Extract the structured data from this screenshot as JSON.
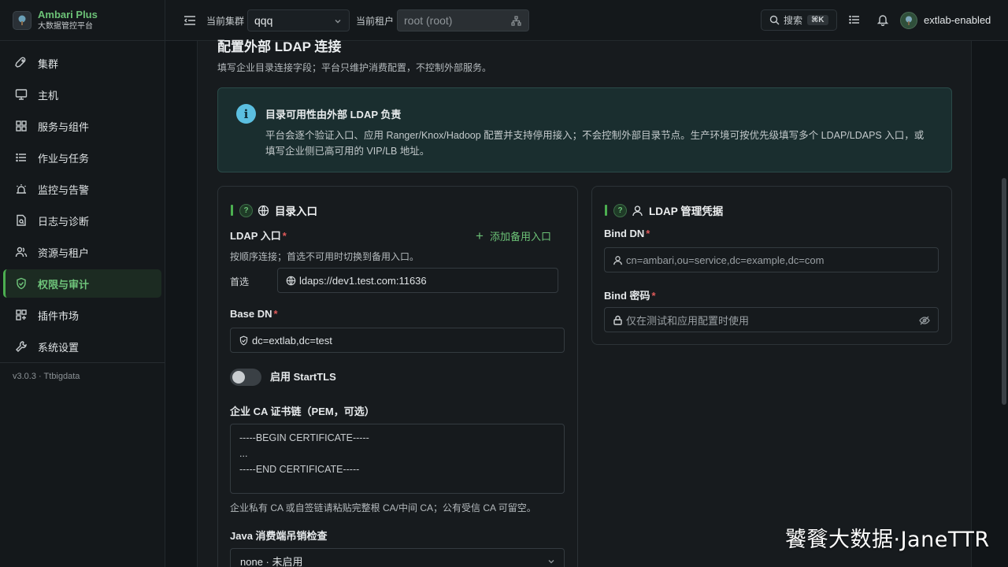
{
  "brand": {
    "name": "Ambari Plus",
    "subtitle": "大数据管控平台"
  },
  "sidebar": {
    "items": [
      {
        "label": "集群",
        "icon": "rocket-icon"
      },
      {
        "label": "主机",
        "icon": "monitor-icon"
      },
      {
        "label": "服务与组件",
        "icon": "grid-icon"
      },
      {
        "label": "作业与任务",
        "icon": "list-icon"
      },
      {
        "label": "监控与告警",
        "icon": "alarm-icon"
      },
      {
        "label": "日志与诊断",
        "icon": "file-search-icon"
      },
      {
        "label": "资源与租户",
        "icon": "users-icon"
      },
      {
        "label": "权限与审计",
        "icon": "shield-check-icon",
        "active": true
      },
      {
        "label": "插件市场",
        "icon": "puzzle-icon"
      },
      {
        "label": "系统设置",
        "icon": "wrench-icon"
      }
    ],
    "version": "v3.0.3 · Ttbigdata"
  },
  "topbar": {
    "cluster_label": "当前集群",
    "cluster_value": "qqq",
    "tenant_label": "当前租户",
    "tenant_value": "root (root)",
    "search_label": "搜索",
    "search_shortcut": "⌘K",
    "user_name": "extlab-enabled"
  },
  "page": {
    "title": "配置外部 LDAP 连接",
    "subtitle": "填写企业目录连接字段；平台只维护消费配置，不控制外部服务。"
  },
  "notice": {
    "title": "目录可用性由外部 LDAP 负责",
    "text": "平台会逐个验证入口、应用 Ranger/Knox/Hadoop 配置并支持停用接入；不会控制外部目录节点。生产环境可按优先级填写多个 LDAP/LDAPS 入口，或填写企业侧已高可用的 VIP/LB 地址。"
  },
  "directory_card": {
    "title": "目录入口",
    "ldap_entry_label": "LDAP 入口",
    "add_backup_label": "添加备用入口",
    "ldap_entry_hint": "按顺序连接；首选不可用时切换到备用入口。",
    "preferred_label": "首选",
    "preferred_value": "ldaps://dev1.test.com:11636",
    "base_dn_label": "Base DN",
    "base_dn_value": "dc=extlab,dc=test",
    "starttls_label": "启用 StartTLS",
    "ca_label": "企业 CA 证书链（PEM，可选）",
    "ca_line1": "-----BEGIN CERTIFICATE-----",
    "ca_line2": "...",
    "ca_line3": "-----END CERTIFICATE-----",
    "ca_hint": "企业私有 CA 或自签链请粘贴完整根 CA/中间 CA；公有受信 CA 可留空。",
    "java_label": "Java 消费端吊销检查",
    "java_value": "none · 未启用"
  },
  "credentials_card": {
    "title": "LDAP 管理凭据",
    "bind_dn_label": "Bind DN",
    "bind_dn_placeholder": "cn=ambari,ou=service,dc=example,dc=com",
    "bind_pw_label": "Bind 密码",
    "bind_pw_placeholder": "仅在测试和应用配置时使用"
  },
  "watermark": "饕餮大数据·JaneTTR",
  "colors": {
    "accent": "#4caf50",
    "accent_text": "#6cc277",
    "info_bg": "#1a2e2f",
    "required": "#e05a5a"
  }
}
